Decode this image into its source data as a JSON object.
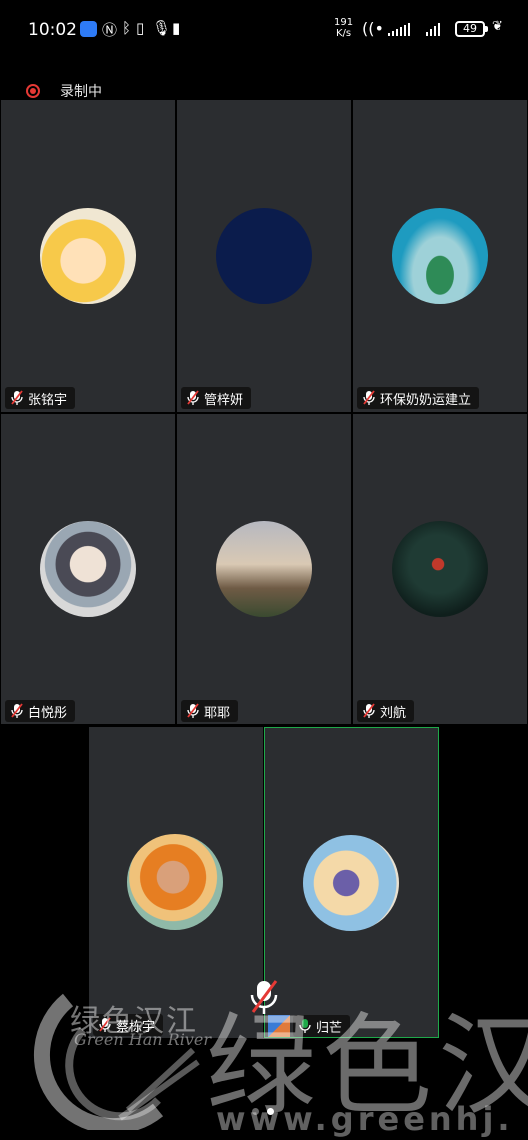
{
  "status_bar": {
    "time": "10:02",
    "net_speed_value": "191",
    "net_speed_unit": "K/s",
    "battery": "49",
    "icons": [
      "app-icon",
      "nfc-icon",
      "bluetooth-icon",
      "mic-icon",
      "vibrate-icon",
      "hotspot-icon",
      "signal-icon",
      "signal-icon",
      "battery-icon",
      "leaf-icon"
    ]
  },
  "recording": {
    "label": "录制中",
    "color": "#e53935"
  },
  "participants": [
    {
      "name": "张铭宇",
      "muted": true,
      "avatar": "cartoon-boy-avatar"
    },
    {
      "name": "管梓妍",
      "muted": true,
      "avatar": "dark-blue-avatar"
    },
    {
      "name": "环保奶奶运建立",
      "muted": true,
      "avatar": "plant-vase-avatar"
    },
    {
      "name": "白悦彤",
      "muted": true,
      "avatar": "anime-girl-avatar"
    },
    {
      "name": "耶耶",
      "muted": true,
      "avatar": "person-photo-avatar"
    },
    {
      "name": "刘航",
      "muted": true,
      "avatar": "flower-photo-avatar"
    },
    {
      "name": "蔡栋宇",
      "muted": true,
      "avatar": "meme-face-avatar"
    },
    {
      "name": "归芒",
      "muted": false,
      "active": true,
      "avatar": "illustration-avatar"
    }
  ],
  "watermark": {
    "cn_small": "绿色汉江",
    "en_small": "Green Han River",
    "cn_large": "绿色汉",
    "url": "www.greenhj."
  },
  "colors": {
    "tile_bg": "#2b2d30",
    "active_border": "#1fa84a",
    "mute_red": "#e53935",
    "mic_green": "#1fa84a"
  },
  "pager": {
    "pages": 2,
    "current": 2
  }
}
